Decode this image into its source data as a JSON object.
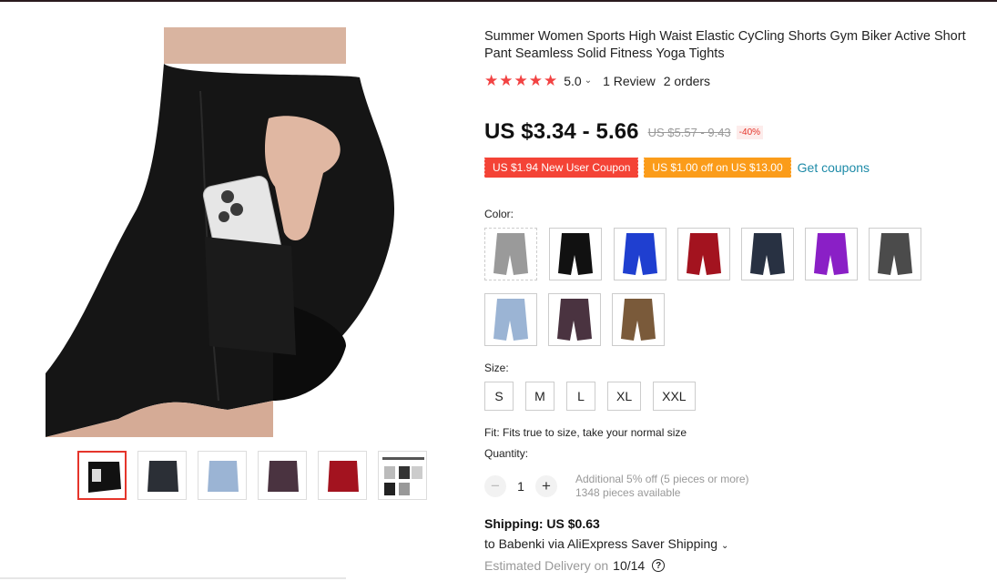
{
  "product": {
    "title": "Summer Women Sports High Waist Elastic CyCling Shorts Gym Biker Active Short Pant Seamless Solid Fitness Yoga Tights",
    "rating": {
      "stars": 5,
      "score": "5.0",
      "reviews": "1 Review",
      "orders": "2 orders"
    },
    "price": {
      "current": "US $3.34 - 5.66",
      "original": "US $5.57 - 9.43",
      "discount": "-40%"
    },
    "coupons": {
      "new_user": "US $1.94 New User Coupon",
      "store": "US $1.00 off on US $13.00",
      "get_link": "Get coupons"
    },
    "color": {
      "label": "Color:",
      "swatches": [
        {
          "name": "Light Gray",
          "hex": "#9a9a9a",
          "disabled": true
        },
        {
          "name": "Black",
          "hex": "#111111"
        },
        {
          "name": "Royal Blue",
          "hex": "#1f3fd0"
        },
        {
          "name": "Red",
          "hex": "#a3131f"
        },
        {
          "name": "Navy",
          "hex": "#283142"
        },
        {
          "name": "Purple",
          "hex": "#8a1fc6"
        },
        {
          "name": "Gray",
          "hex": "#4b4b4b"
        },
        {
          "name": "Light Blue",
          "hex": "#9bb4d4"
        },
        {
          "name": "Plum",
          "hex": "#4a3340"
        },
        {
          "name": "Brown",
          "hex": "#7a5a3a"
        }
      ]
    },
    "size": {
      "label": "Size:",
      "options": [
        "S",
        "M",
        "L",
        "XL",
        "XXL"
      ]
    },
    "fit": "Fit: Fits true to size, take your normal size",
    "quantity": {
      "label": "Quantity:",
      "value": "1",
      "minus": "−",
      "plus": "+",
      "discount_note": "Additional 5% off (5 pieces or more)",
      "available": "1348 pieces available"
    },
    "shipping": {
      "title": "Shipping: US $0.63",
      "detail": "to Babenki via AliExpress Saver Shipping",
      "delivery_label": "Estimated Delivery on",
      "delivery_date": "10/14",
      "help": "?"
    },
    "thumbnails": [
      {
        "name": "Black with phone",
        "hex": "#111111",
        "active": true
      },
      {
        "name": "Charcoal",
        "hex": "#2b2f36"
      },
      {
        "name": "Light Blue",
        "hex": "#9bb4d4"
      },
      {
        "name": "Plum",
        "hex": "#4a3340"
      },
      {
        "name": "Red",
        "hex": "#a3131f"
      },
      {
        "name": "Size chart",
        "hex": "#dddddd"
      }
    ]
  },
  "colors": {
    "accent": "#e5352b",
    "coupon_red": "#f44336",
    "coupon_orange": "#fb9c1a",
    "link": "#1e8ba8"
  }
}
